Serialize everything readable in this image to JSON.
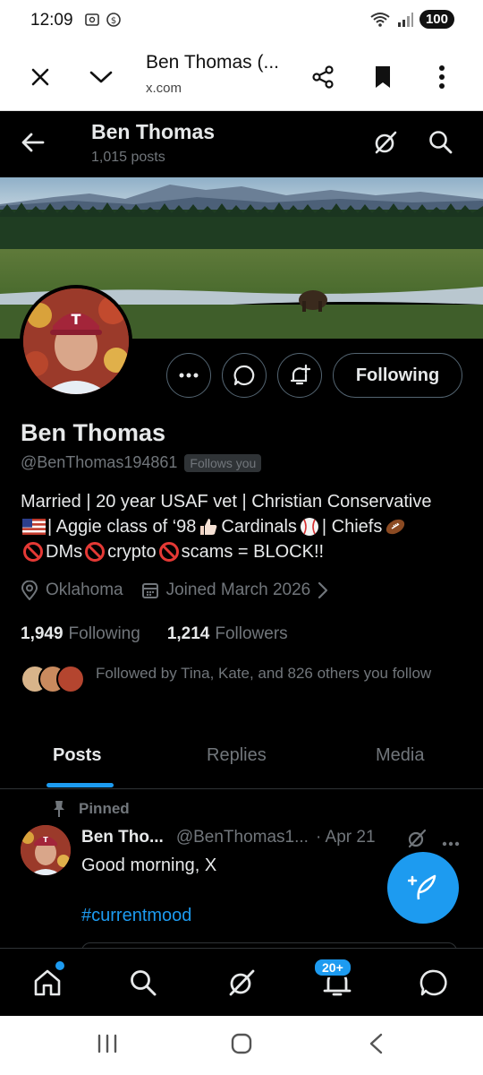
{
  "status_bar": {
    "time": "12:09",
    "battery": "100"
  },
  "browser": {
    "title": "Ben Thomas (...",
    "url": "x.com"
  },
  "profile_header": {
    "name": "Ben Thomas",
    "posts_count": "1,015 posts"
  },
  "profile": {
    "display_name": "Ben Thomas",
    "handle": "@BenThomas194861",
    "follows_you": "Follows you",
    "bio": {
      "line1": "Married | 20 year USAF vet | Christian Conservative",
      "line2_a": "| Aggie class of ‘98",
      "line2_b": "Cardinals",
      "line2_c": "| Chiefs",
      "line3_a": "DMs",
      "line3_b": "crypto",
      "line3_c": "scams = BLOCK!!"
    },
    "location": "Oklahoma",
    "joined": "Joined March 2026",
    "following_count": "1,949",
    "following_label": "Following",
    "followers_count": "1,214",
    "followers_label": "Followers",
    "followed_by": "Followed by Tina, Kate, and 826 others you follow",
    "following_button": "Following"
  },
  "tabs": [
    {
      "label": "Posts",
      "active": true
    },
    {
      "label": "Replies",
      "active": false
    },
    {
      "label": "Media",
      "active": false
    }
  ],
  "pinned_post": {
    "pinned_label": "Pinned",
    "author_name": "Ben Tho...",
    "author_handle": "@BenThomas1...",
    "date": "· Apr 21",
    "text": "Good morning, X",
    "hashtag": "#currentmood"
  },
  "bottom_nav": {
    "notifications_badge": "20+"
  },
  "colors": {
    "accent": "#1d9bf0",
    "background": "#000000",
    "secondary_text": "#71767b",
    "primary_text": "#e7e9ea"
  },
  "icons": [
    "close-icon",
    "chevron-down-icon",
    "share-icon",
    "bookmark-icon",
    "more-vertical-icon",
    "back-arrow-icon",
    "grok-icon",
    "search-icon",
    "more-horizontal-icon",
    "message-icon",
    "notification-add-icon",
    "location-icon",
    "calendar-icon",
    "pin-icon",
    "compose-icon",
    "home-icon",
    "bell-icon",
    "mail-icon"
  ]
}
